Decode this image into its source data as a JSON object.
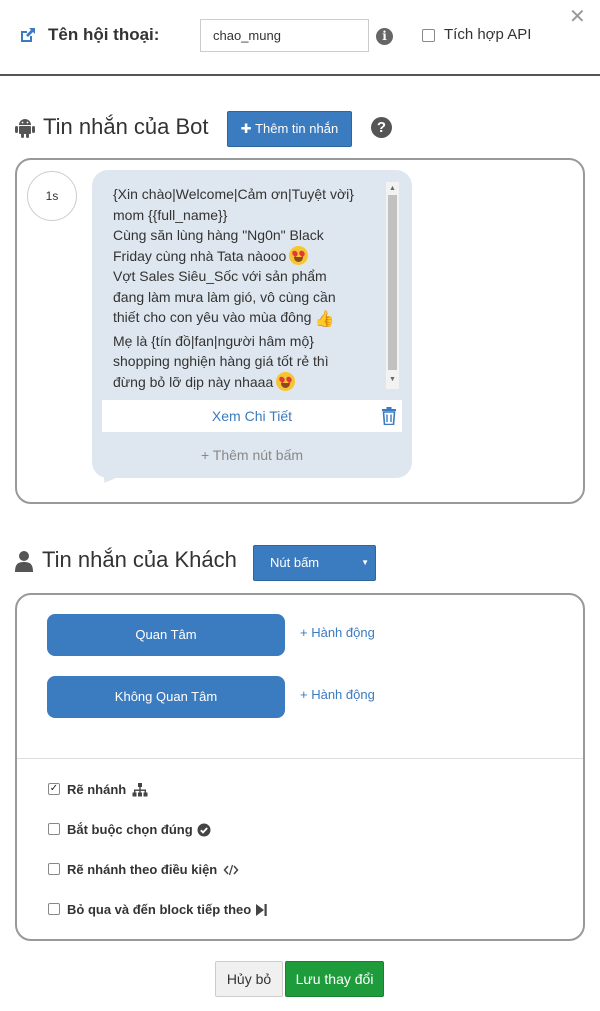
{
  "header": {
    "conversation_label": "Tên hội thoại:",
    "conversation_value": "chao_mung",
    "api_label": "Tích hợp API",
    "api_checked": false,
    "close_glyph": "✕"
  },
  "bot": {
    "title": "Tin nhắn của Bot",
    "add_message_label": "Thêm tin nhắn",
    "add_message_glyph": "✚",
    "help_glyph": "?",
    "delay": "1s",
    "message_lines": [
      "{Xin chào|Welcome|Cảm ơn|Tuyệt vời}",
      "mom {{full_name}}",
      "Cùng săn lùng hàng \"Ng0n\" Black",
      "Friday cùng nhà Tata nàooo",
      "Vợt Sales Siêu_Sốc với sản phẩm",
      "đang làm mưa làm gió, vô cùng cần",
      "thiết cho con yêu vào mùa đông",
      "Mẹ là {tín đồ|fan|người hâm mộ}",
      "shopping nghiện hàng giá tốt rẻ thì",
      "đừng bỏ lỡ dịp này nhaaa"
    ],
    "emoji_heart_eyes": "heart-eyes-emoji",
    "emoji_thumbs_up": "thumbs-up-emoji",
    "button_label": "Xem Chi Tiết",
    "add_button_label": "+ Thêm nút bấm"
  },
  "customer": {
    "title": "Tin nhắn của Khách",
    "type_select_value": "Nút bấm",
    "quick_replies": [
      {
        "label": "Quan Tâm",
        "action": "+ Hành động"
      },
      {
        "label": "Không Quan Tâm",
        "action": "+ Hành động"
      }
    ],
    "options": [
      {
        "label": "Rẽ nhánh",
        "checked": true,
        "icon": "sitemap-icon"
      },
      {
        "label": "Bắt buộc chọn đúng",
        "checked": false,
        "icon": "check-circle-icon"
      },
      {
        "label": "Rẽ nhánh theo điều kiện",
        "checked": false,
        "icon": "code-icon"
      },
      {
        "label": "Bỏ qua và đến block tiếp theo",
        "checked": false,
        "icon": "step-forward-icon"
      }
    ]
  },
  "footer": {
    "cancel_label": "Hủy bỏ",
    "save_label": "Lưu thay đổi"
  },
  "colors": {
    "primary": "#3b7bbf",
    "save": "#1e9c3c",
    "bubble": "#dee7ef",
    "border": "#999999"
  }
}
